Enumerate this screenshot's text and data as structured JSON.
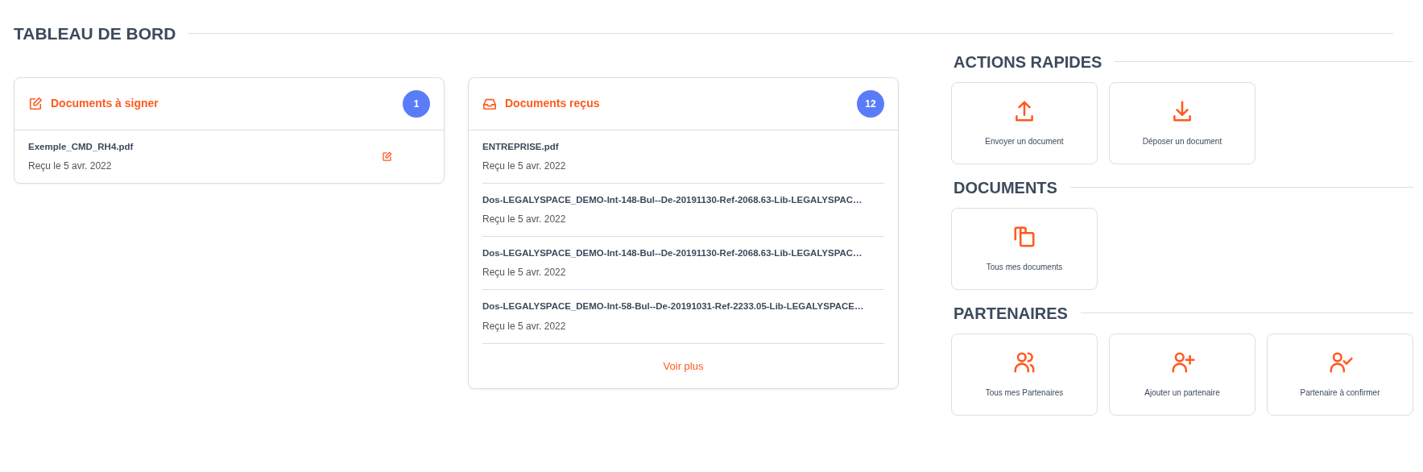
{
  "title": "TABLEAU DE BORD",
  "cards": [
    {
      "title": "Documents à signer",
      "count": "1",
      "items": [
        {
          "name": "Exemple_CMD_RH4.pdf",
          "date": "Reçu le 5 avr. 2022",
          "kind": "sign"
        }
      ]
    },
    {
      "title": "Documents reçus",
      "count": "12",
      "items": [
        {
          "name": "ENTREPRISE.pdf",
          "date": "Reçu le 5 avr. 2022",
          "kind": "plain"
        },
        {
          "name": "Dos-LEGALYSPACE_DEMO-Int-148-Bul--De-20191130-Ref-2068.63-Lib-LEGALYSPAC…",
          "date": "Reçu le 5 avr. 2022",
          "kind": "plain"
        },
        {
          "name": "Dos-LEGALYSPACE_DEMO-Int-148-Bul--De-20191130-Ref-2068.63-Lib-LEGALYSPAC…",
          "date": "Reçu le 5 avr. 2022",
          "kind": "plain"
        },
        {
          "name": "Dos-LEGALYSPACE_DEMO-Int-58-Bul--De-20191031-Ref-2233.05-Lib-LEGALYSPACE…",
          "date": "Reçu le 5 avr. 2022",
          "kind": "plain"
        }
      ],
      "more": "Voir plus"
    }
  ],
  "sections": [
    {
      "title": "ACTIONS RAPIDES",
      "tiles": [
        {
          "label": "Envoyer un document"
        },
        {
          "label": "Déposer un document"
        }
      ]
    },
    {
      "title": "DOCUMENTS",
      "tiles": [
        {
          "label": "Tous mes documents"
        }
      ]
    },
    {
      "title": "PARTENAIRES",
      "tiles": [
        {
          "label": "Tous mes Partenaires"
        },
        {
          "label": "Ajouter un partenaire"
        },
        {
          "label": "Partenaire à confirmer"
        }
      ]
    }
  ]
}
